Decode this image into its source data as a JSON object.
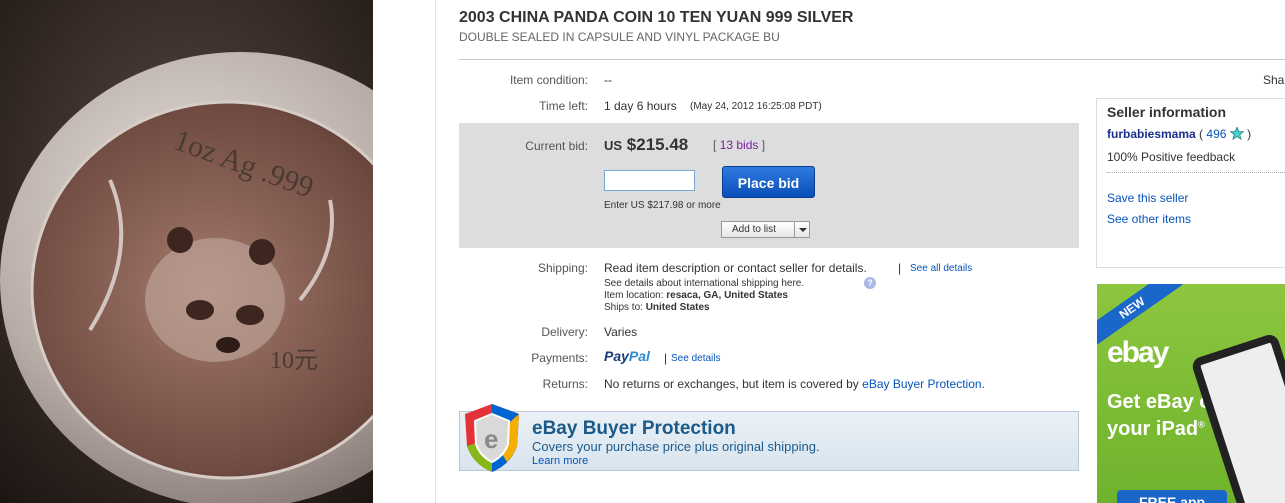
{
  "listing": {
    "title": "2003 CHINA PANDA COIN 10 TEN YUAN 999 SILVER",
    "subtitle": "DOUBLE SEALED IN CAPSULE AND VINYL PACKAGE BU"
  },
  "share_label": "Sha",
  "photo": {
    "coin_inscription": "1oz Ag .999",
    "coin_denomination": "10元"
  },
  "details": {
    "condition_label": "Item condition:",
    "condition_value": "--",
    "time_left_label": "Time left:",
    "time_left_value": "1 day 6 hours",
    "time_left_date": "(May 24, 2012 16:25:08 PDT)"
  },
  "bid": {
    "current_bid_label": "Current bid:",
    "currency": "US",
    "price": "$215.48",
    "bids_open": "[",
    "bids_link": "13 bids",
    "bids_close": "]",
    "input_value": "",
    "place_bid_label": "Place bid",
    "enter_hint": "Enter US $217.98 or more",
    "add_to_list_label": "Add to list"
  },
  "shipping": {
    "label": "Shipping:",
    "value": "Read item description or contact seller for details.",
    "separator": "|",
    "see_all_link": "See all details",
    "intl_note": "See details about international shipping here.",
    "help_icon_text": "?",
    "location_label": "Item location:",
    "location_value": "resaca, GA, United States",
    "ships_to_label": "Ships to:",
    "ships_to_value": "United States"
  },
  "delivery": {
    "label": "Delivery:",
    "value": "Varies"
  },
  "payments": {
    "label": "Payments:",
    "paypal_pay": "Pay",
    "paypal_pal": "Pal",
    "separator": "|",
    "see_details_link": "See details"
  },
  "returns": {
    "label": "Returns:",
    "value": "No returns or exchanges, but item is covered by",
    "link": "eBay Buyer Protection",
    "end": "."
  },
  "protection": {
    "title": "eBay Buyer Protection",
    "subtitle": "Covers your purchase price plus original shipping.",
    "learn_more": "Learn more"
  },
  "seller": {
    "title": "Seller information",
    "name": "furbabiesmama",
    "score_open": "(",
    "score": "496",
    "score_close": ")",
    "feedback": "100% Positive feedback",
    "save_link": "Save this seller",
    "other_items_link": "See other items"
  },
  "ad": {
    "badge": "NEW",
    "logo": "ebay",
    "line1": "Get eBay on",
    "line2": "your iPad",
    "trademark": "®",
    "cta": "FREE app"
  },
  "colors": {
    "link": "#0654ba",
    "bid_button": "#1a63cc",
    "bid_box": "#dddddd",
    "ad_green": "#7ebc34"
  }
}
